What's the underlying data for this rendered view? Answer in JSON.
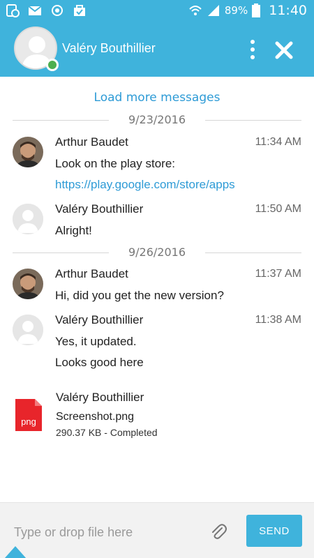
{
  "status_bar": {
    "battery_percent": "89%",
    "time": "11:40",
    "icons": [
      "timer-icon",
      "gmail-icon",
      "sync-icon",
      "shopping-icon",
      "wifi-icon",
      "signal-icon",
      "battery-icon"
    ]
  },
  "header": {
    "title": "Valéry Bouthillier",
    "online_status_color": "#4caf50",
    "accent_color": "#3fb3dc"
  },
  "load_more_label": "Load more messages",
  "conversation": {
    "days": [
      {
        "date": "9/23/2016",
        "messages": [
          {
            "sender": "Arthur Baudet",
            "time": "11:34 AM",
            "lines": [
              "Look on the play store:",
              "https://play.google.com/store/apps"
            ]
          },
          {
            "sender": "Valéry Bouthillier",
            "time": "11:50 AM",
            "lines": [
              "Alright!"
            ]
          }
        ]
      },
      {
        "date": "9/26/2016",
        "messages": [
          {
            "sender": "Arthur Baudet",
            "time": "11:37 AM",
            "lines": [
              "Hi, did you get the new version?"
            ]
          },
          {
            "sender": "Valéry Bouthillier",
            "time": "11:38 AM",
            "lines": [
              "Yes, it updated.",
              "Looks good here"
            ]
          }
        ]
      }
    ],
    "file_message": {
      "sender": "Valéry Bouthillier",
      "file_name": "Screenshot.png",
      "file_meta": "290.37 KB - Completed",
      "icon_label": "png"
    }
  },
  "composer": {
    "placeholder": "Type or drop file here",
    "value": "",
    "send_label": "SEND"
  }
}
